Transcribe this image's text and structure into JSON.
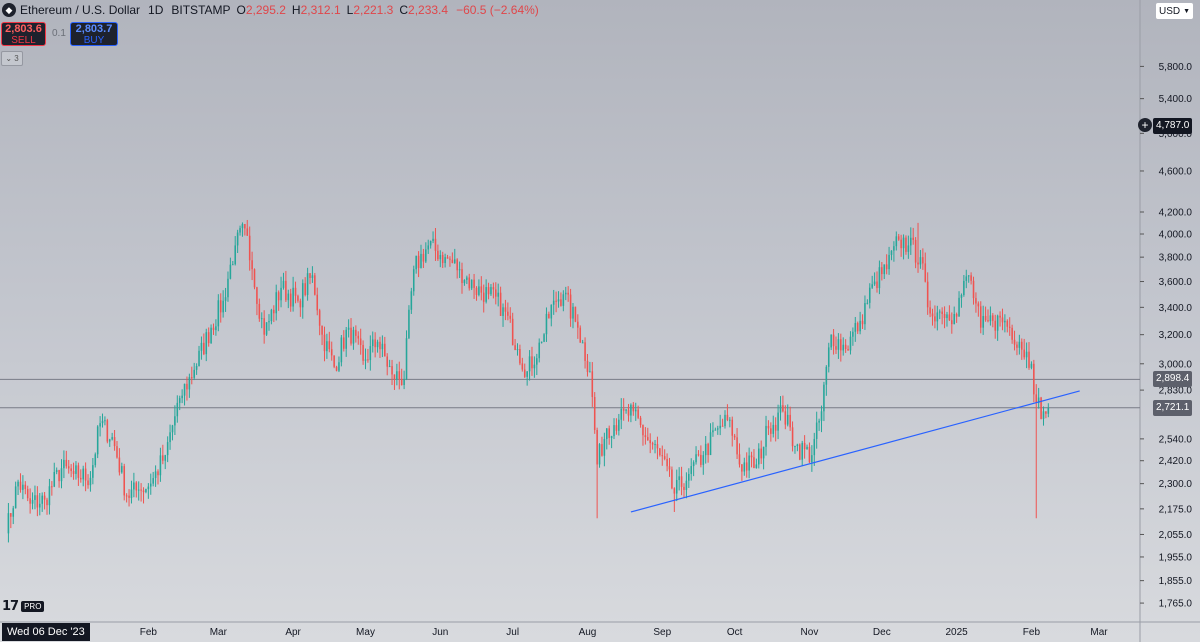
{
  "header": {
    "symbol": "Ethereum / U.S. Dollar",
    "interval": "1D",
    "exchange": "BITSTAMP",
    "open_label": "O",
    "open": "2,295.2",
    "high_label": "H",
    "high": "2,312.1",
    "low_label": "L",
    "low": "2,221.3",
    "close_label": "C",
    "close": "2,233.4",
    "change": "−60.5 (−2.64%)"
  },
  "trade": {
    "sell_price": "2,803.6",
    "sell_label": "SELL",
    "buy_price": "2,803.7",
    "buy_label": "BUY",
    "spread": "0.1"
  },
  "collapse_label": "⌄ 3",
  "currency": "USD",
  "price_badges": {
    "alert": "4,787.0",
    "level1": "2,898.4",
    "level2": "2,721.1"
  },
  "date_badge": "Wed 06 Dec '23",
  "logo_badge": "PRO",
  "colors": {
    "up": "#26a69a",
    "down": "#ef5350",
    "trendline": "#2962ff",
    "hline": "#787b86",
    "background_top": "#b1b4bd",
    "background_bottom": "#d8dade"
  },
  "chart_data": {
    "type": "candlestick",
    "scale": "log",
    "y_ticks": [
      5800,
      5400,
      5000,
      4600,
      4200,
      4000,
      3800,
      3600,
      3400,
      3200,
      3000,
      2830,
      2540,
      2420,
      2300,
      2175,
      2055,
      1955,
      1855,
      1765
    ],
    "y_tick_labels": [
      "5,800.0",
      "5,400.0",
      "5,000.0",
      "4,600.0",
      "4,200.0",
      "4,000.0",
      "3,800.0",
      "3,600.0",
      "3,400.0",
      "3,200.0",
      "3,000.0",
      "2,830.0",
      "2,540.0",
      "2,420.0",
      "2,300.0",
      "2,175.0",
      "2,055.0",
      "1,955.0",
      "1,855.0",
      "1,765.0"
    ],
    "x_labels": [
      {
        "date": "2024-01-01",
        "label": "2024"
      },
      {
        "date": "2024-02-01",
        "label": "Feb"
      },
      {
        "date": "2024-03-01",
        "label": "Mar"
      },
      {
        "date": "2024-04-01",
        "label": "Apr"
      },
      {
        "date": "2024-05-01",
        "label": "May"
      },
      {
        "date": "2024-06-01",
        "label": "Jun"
      },
      {
        "date": "2024-07-01",
        "label": "Jul"
      },
      {
        "date": "2024-08-01",
        "label": "Aug"
      },
      {
        "date": "2024-09-01",
        "label": "Sep"
      },
      {
        "date": "2024-10-01",
        "label": "Oct"
      },
      {
        "date": "2024-11-01",
        "label": "Nov"
      },
      {
        "date": "2024-12-01",
        "label": "Dec"
      },
      {
        "date": "2025-01-01",
        "label": "2025"
      },
      {
        "date": "2025-02-01",
        "label": "Feb"
      },
      {
        "date": "2025-03-01",
        "label": "Mar"
      }
    ],
    "x_range": [
      "2023-12-04",
      "2025-03-18"
    ],
    "horizontal_lines": [
      2898.4,
      2721.1
    ],
    "trendline": [
      {
        "date": "2024-08-19",
        "price": 2160
      },
      {
        "date": "2025-02-21",
        "price": 2825
      }
    ],
    "closes": [
      {
        "date": "2023-12-04",
        "close": 2060
      },
      {
        "date": "2023-12-09",
        "close": 2310
      },
      {
        "date": "2023-12-14",
        "close": 2200
      },
      {
        "date": "2023-12-20",
        "close": 2220
      },
      {
        "date": "2023-12-27",
        "close": 2380
      },
      {
        "date": "2024-01-01",
        "close": 2350
      },
      {
        "date": "2024-01-08",
        "close": 2330
      },
      {
        "date": "2024-01-12",
        "close": 2630
      },
      {
        "date": "2024-01-17",
        "close": 2550
      },
      {
        "date": "2024-01-23",
        "close": 2240
      },
      {
        "date": "2024-01-28",
        "close": 2270
      },
      {
        "date": "2024-02-02",
        "close": 2300
      },
      {
        "date": "2024-02-08",
        "close": 2450
      },
      {
        "date": "2024-02-14",
        "close": 2780
      },
      {
        "date": "2024-02-20",
        "close": 2960
      },
      {
        "date": "2024-02-27",
        "close": 3250
      },
      {
        "date": "2024-03-03",
        "close": 3450
      },
      {
        "date": "2024-03-08",
        "close": 3900
      },
      {
        "date": "2024-03-12",
        "close": 4050
      },
      {
        "date": "2024-03-15",
        "close": 3700
      },
      {
        "date": "2024-03-20",
        "close": 3200
      },
      {
        "date": "2024-03-27",
        "close": 3550
      },
      {
        "date": "2024-04-03",
        "close": 3450
      },
      {
        "date": "2024-04-09",
        "close": 3650
      },
      {
        "date": "2024-04-13",
        "close": 3200
      },
      {
        "date": "2024-04-18",
        "close": 2980
      },
      {
        "date": "2024-04-24",
        "close": 3250
      },
      {
        "date": "2024-04-30",
        "close": 3020
      },
      {
        "date": "2024-05-06",
        "close": 3150
      },
      {
        "date": "2024-05-12",
        "close": 2930
      },
      {
        "date": "2024-05-17",
        "close": 2900
      },
      {
        "date": "2024-05-21",
        "close": 3700
      },
      {
        "date": "2024-05-27",
        "close": 3900
      },
      {
        "date": "2024-06-03",
        "close": 3800
      },
      {
        "date": "2024-06-09",
        "close": 3700
      },
      {
        "date": "2024-06-15",
        "close": 3550
      },
      {
        "date": "2024-06-21",
        "close": 3500
      },
      {
        "date": "2024-06-27",
        "close": 3400
      },
      {
        "date": "2024-07-03",
        "close": 3100
      },
      {
        "date": "2024-07-07",
        "close": 2950
      },
      {
        "date": "2024-07-13",
        "close": 3150
      },
      {
        "date": "2024-07-18",
        "close": 3450
      },
      {
        "date": "2024-07-22",
        "close": 3500
      },
      {
        "date": "2024-07-28",
        "close": 3250
      },
      {
        "date": "2024-08-02",
        "close": 2950
      },
      {
        "date": "2024-08-05",
        "close": 2400
      },
      {
        "date": "2024-08-09",
        "close": 2600
      },
      {
        "date": "2024-08-14",
        "close": 2650
      },
      {
        "date": "2024-08-20",
        "close": 2700
      },
      {
        "date": "2024-08-25",
        "close": 2550
      },
      {
        "date": "2024-08-31",
        "close": 2450
      },
      {
        "date": "2024-09-06",
        "close": 2250
      },
      {
        "date": "2024-09-12",
        "close": 2350
      },
      {
        "date": "2024-09-18",
        "close": 2450
      },
      {
        "date": "2024-09-24",
        "close": 2600
      },
      {
        "date": "2024-09-29",
        "close": 2650
      },
      {
        "date": "2024-10-03",
        "close": 2400
      },
      {
        "date": "2024-10-10",
        "close": 2400
      },
      {
        "date": "2024-10-15",
        "close": 2600
      },
      {
        "date": "2024-10-21",
        "close": 2700
      },
      {
        "date": "2024-10-26",
        "close": 2500
      },
      {
        "date": "2024-11-02",
        "close": 2450
      },
      {
        "date": "2024-11-06",
        "close": 2700
      },
      {
        "date": "2024-11-10",
        "close": 3200
      },
      {
        "date": "2024-11-16",
        "close": 3100
      },
      {
        "date": "2024-11-22",
        "close": 3300
      },
      {
        "date": "2024-11-28",
        "close": 3600
      },
      {
        "date": "2024-12-03",
        "close": 3700
      },
      {
        "date": "2024-12-08",
        "close": 3950
      },
      {
        "date": "2024-12-12",
        "close": 3900
      },
      {
        "date": "2024-12-17",
        "close": 3800
      },
      {
        "date": "2024-12-20",
        "close": 3400
      },
      {
        "date": "2024-12-26",
        "close": 3350
      },
      {
        "date": "2024-12-31",
        "close": 3350
      },
      {
        "date": "2025-01-06",
        "close": 3650
      },
      {
        "date": "2025-01-11",
        "close": 3250
      },
      {
        "date": "2025-01-16",
        "close": 3300
      },
      {
        "date": "2025-01-21",
        "close": 3300
      },
      {
        "date": "2025-01-27",
        "close": 3150
      },
      {
        "date": "2025-02-01",
        "close": 3000
      },
      {
        "date": "2025-02-03",
        "close": 2750
      },
      {
        "date": "2025-02-06",
        "close": 2700
      },
      {
        "date": "2025-02-08",
        "close": 2720
      }
    ],
    "wick_overrides": [
      {
        "date": "2024-08-05",
        "low": 2130
      },
      {
        "date": "2025-02-03",
        "low": 2130
      },
      {
        "date": "2024-03-12",
        "high": 4090
      },
      {
        "date": "2024-12-16",
        "high": 4100
      },
      {
        "date": "2024-05-27",
        "high": 3950
      },
      {
        "date": "2024-09-06",
        "low": 2160
      }
    ]
  }
}
